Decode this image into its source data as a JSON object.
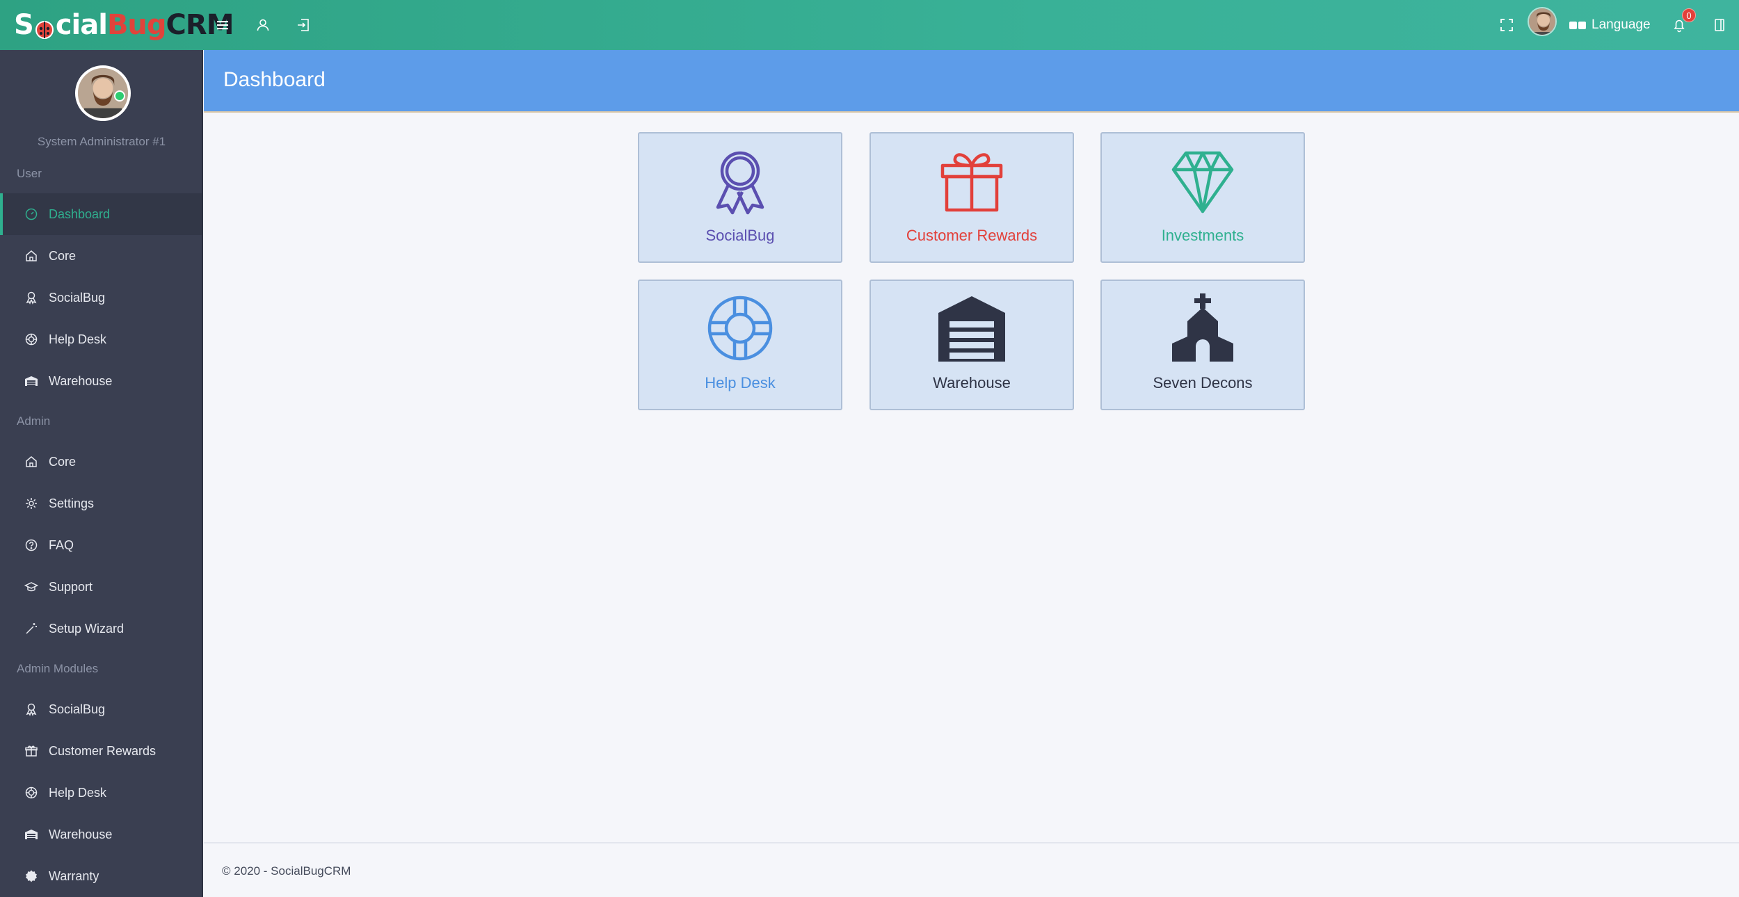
{
  "topbar": {
    "logo": {
      "part1": "S",
      "part2": "cial",
      "part3": "Bug",
      "part4": "CRM",
      "ladybug_letter": "o"
    },
    "language_label": "Language",
    "notification_count": "0",
    "icons": [
      "menu-icon",
      "user-icon",
      "logout-icon",
      "fullscreen-icon",
      "language-flag-icon",
      "bell-icon",
      "panel-toggle-icon"
    ]
  },
  "sidebar": {
    "profile_name": "System Administrator #1",
    "sections": [
      {
        "title": "User"
      },
      {
        "title": "Admin"
      },
      {
        "title": "Admin Modules"
      }
    ],
    "user_items": [
      {
        "label": "Dashboard",
        "icon": "dashboard-icon"
      },
      {
        "label": "Core",
        "icon": "home-icon"
      },
      {
        "label": "SocialBug",
        "icon": "ribbon-icon"
      },
      {
        "label": "Help Desk",
        "icon": "lifebuoy-icon"
      },
      {
        "label": "Warehouse",
        "icon": "warehouse-icon"
      }
    ],
    "admin_items": [
      {
        "label": "Core",
        "icon": "home-icon"
      },
      {
        "label": "Settings",
        "icon": "gear-icon"
      },
      {
        "label": "FAQ",
        "icon": "question-icon"
      },
      {
        "label": "Support",
        "icon": "graduation-icon"
      },
      {
        "label": "Setup Wizard",
        "icon": "magic-wand-icon"
      }
    ],
    "module_items": [
      {
        "label": "SocialBug",
        "icon": "ribbon-icon"
      },
      {
        "label": "Customer Rewards",
        "icon": "gift-icon"
      },
      {
        "label": "Help Desk",
        "icon": "lifebuoy-icon"
      },
      {
        "label": "Warehouse",
        "icon": "warehouse-icon"
      },
      {
        "label": "Warranty",
        "icon": "badge-icon"
      }
    ]
  },
  "page": {
    "title": "Dashboard"
  },
  "tiles": [
    {
      "label": "SocialBug",
      "icon": "ribbon-icon",
      "color": "#5b4fb0"
    },
    {
      "label": "Customer Rewards",
      "icon": "gift-icon",
      "color": "#e2403a"
    },
    {
      "label": "Investments",
      "icon": "diamond-icon",
      "color": "#2fb08f"
    },
    {
      "label": "Help Desk",
      "icon": "lifebuoy-icon",
      "color": "#4a8fe0"
    },
    {
      "label": "Warehouse",
      "icon": "warehouse-icon",
      "color": "#2f3446"
    },
    {
      "label": "Seven Decons",
      "icon": "church-icon",
      "color": "#2f3446"
    }
  ],
  "footer": {
    "text": "© 2020 - SocialBugCRM"
  },
  "colors": {
    "topbar": "#34a98e",
    "sidebar": "#3a3f51",
    "header": "#5d9ce9",
    "accent": "#2fb08f"
  }
}
